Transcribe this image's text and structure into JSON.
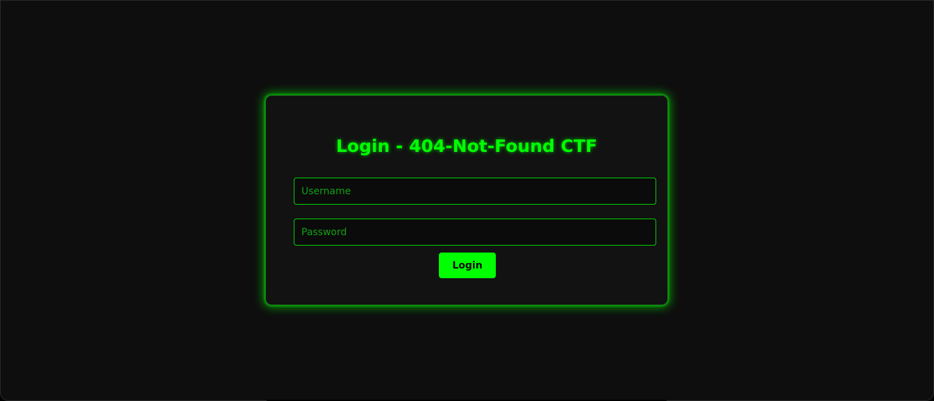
{
  "login": {
    "title": "Login - 404-Not-Found CTF",
    "username_placeholder": "Username",
    "password_placeholder": "Password",
    "submit_label": "Login"
  },
  "colors": {
    "accent": "#00ff00",
    "background": "#0e0e0e",
    "card": "#121212"
  }
}
